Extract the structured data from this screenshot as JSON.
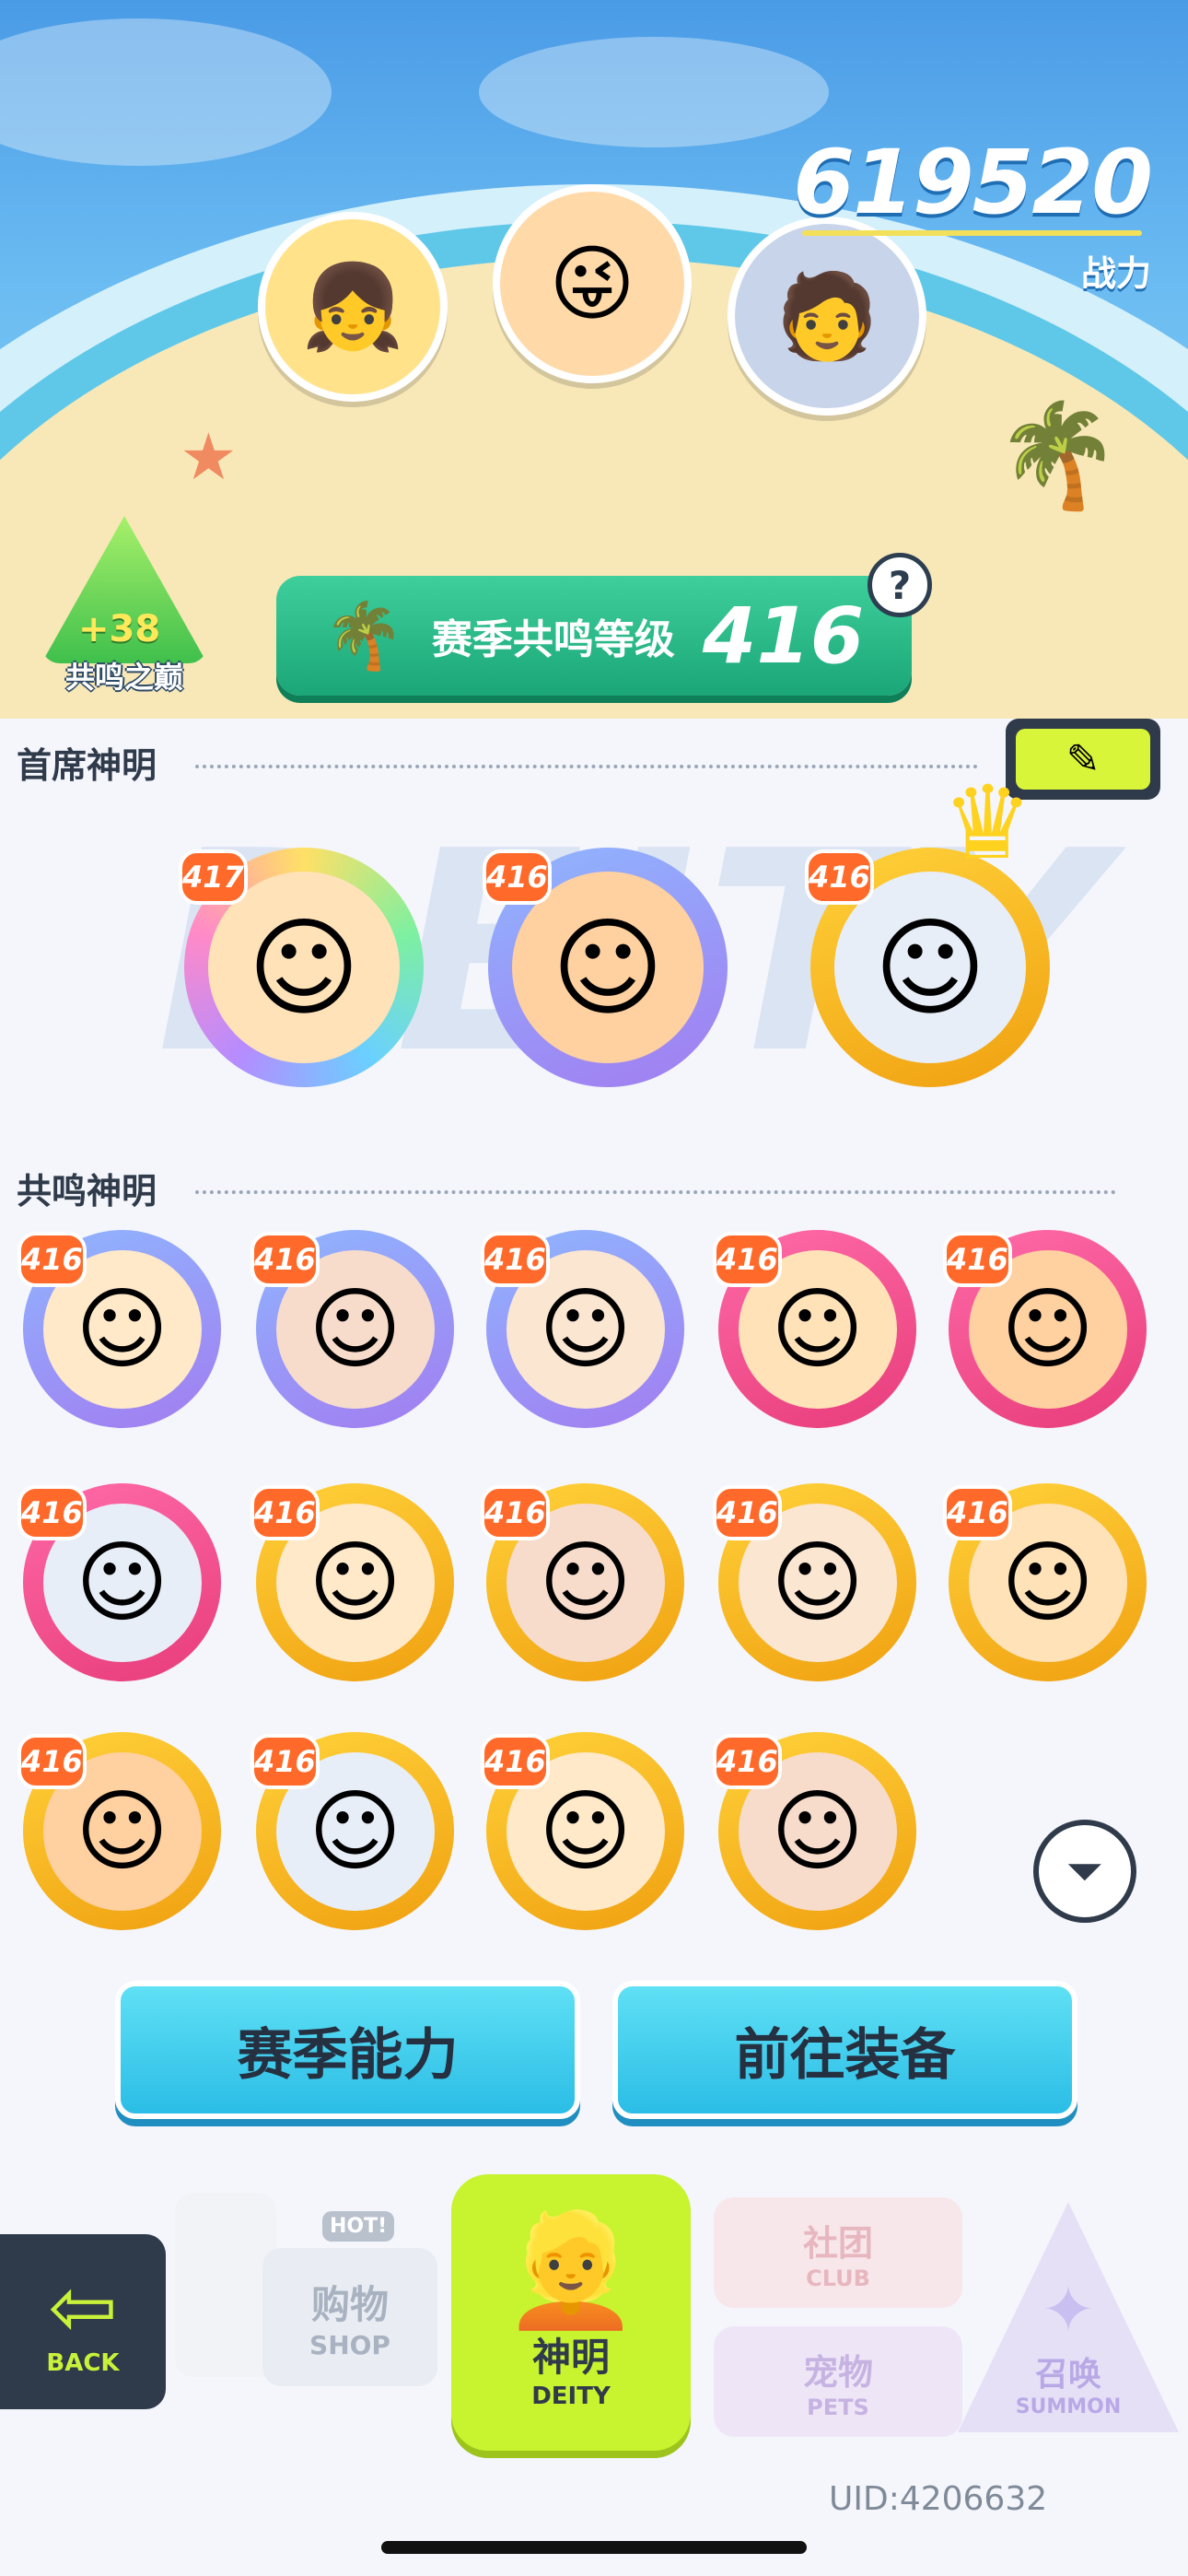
{
  "top": {
    "combat_power": {
      "value": "619520",
      "label": "战力"
    },
    "peak_badge": {
      "bonus": "+38",
      "label": "共鸣之巅"
    },
    "season_level": {
      "label": "赛季共鸣等级",
      "value": "416"
    },
    "help": "?"
  },
  "sections": {
    "chief_title": "首席神明",
    "resonance_title": "共鸣神明"
  },
  "watermark": "DEITY",
  "chief_deities": [
    {
      "level": "417",
      "ring": "rainbow",
      "crown": false,
      "icon": "yellow-hair-girl"
    },
    {
      "level": "416",
      "ring": "purple",
      "crown": false,
      "icon": "orange-hair-girl"
    },
    {
      "level": "416",
      "ring": "gold",
      "crown": true,
      "icon": "silver-hair-boy"
    }
  ],
  "resonance_deities": [
    {
      "level": "416",
      "ring": "purple"
    },
    {
      "level": "416",
      "ring": "purple"
    },
    {
      "level": "416",
      "ring": "purple"
    },
    {
      "level": "416",
      "ring": "pink"
    },
    {
      "level": "416",
      "ring": "pink"
    },
    {
      "level": "416",
      "ring": "pink"
    },
    {
      "level": "416",
      "ring": "gold"
    },
    {
      "level": "416",
      "ring": "gold"
    },
    {
      "level": "416",
      "ring": "gold"
    },
    {
      "level": "416",
      "ring": "gold"
    },
    {
      "level": "416",
      "ring": "gold"
    },
    {
      "level": "416",
      "ring": "gold"
    },
    {
      "level": "416",
      "ring": "gold"
    },
    {
      "level": "416",
      "ring": "gold"
    }
  ],
  "buttons": {
    "season_ability": "赛季能力",
    "go_equipment": "前往装备"
  },
  "bottom_nav": {
    "back": {
      "en": "BACK"
    },
    "shop": {
      "cn": "购物",
      "en": "SHOP",
      "tag": "HOT!"
    },
    "deity": {
      "cn": "神明",
      "en": "DEITY"
    },
    "club": {
      "cn": "社团",
      "en": "CLUB"
    },
    "pets": {
      "cn": "宠物",
      "en": "PETS"
    },
    "summon": {
      "cn": "召唤",
      "en": "SUMMON"
    }
  },
  "uid": "UID:4206632",
  "colors": {
    "rainbow": "#b8f0ff",
    "purple": "#9a7cf0",
    "pink": "#f0508f",
    "gold": "#f5b820",
    "level_badge": "#ff6a2a",
    "accent_green": "#1ba677"
  }
}
